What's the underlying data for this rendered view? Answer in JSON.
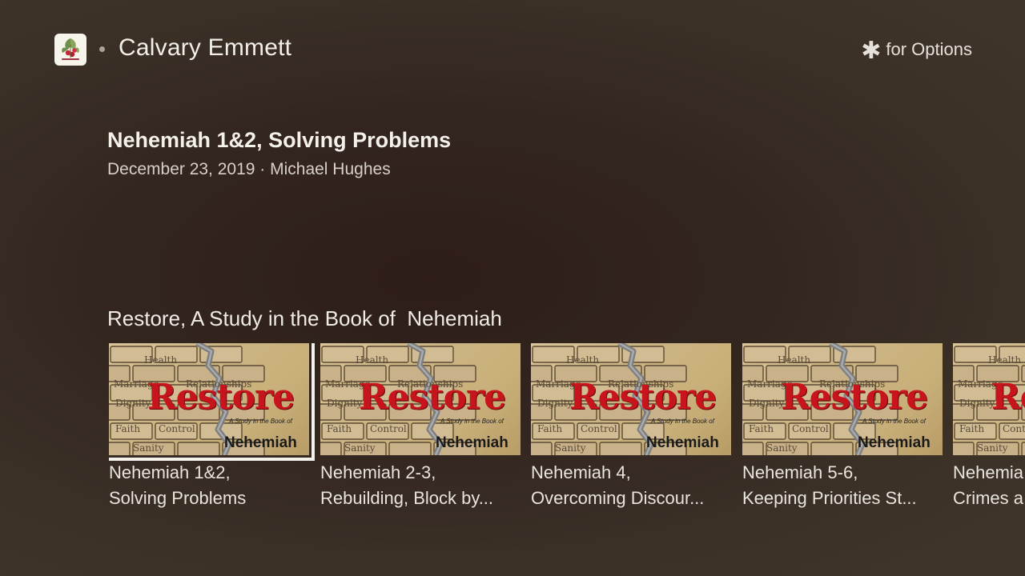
{
  "header": {
    "channel_name": "Calvary Emmett",
    "options_symbol": "✱",
    "options_text": "for Options"
  },
  "episode": {
    "title": "Nehemiah 1&2, Solving Problems",
    "meta": "December 23, 2019 · Michael Hughes"
  },
  "row": {
    "title": "Restore, A Study in the Book of  Nehemiah",
    "thumb": {
      "main_word": "Restore",
      "subtitle": "A Study in the Book of",
      "book": "Nehemiah",
      "brick_words": [
        "Health",
        "Marriage",
        "Relationships",
        "Dignity",
        "Faith",
        "Control",
        "Sanity"
      ]
    },
    "items": [
      {
        "line1": "Nehemiah 1&2,",
        "line2": "Solving Problems"
      },
      {
        "line1": "Nehemiah 2-3,",
        "line2": "Rebuilding, Block by..."
      },
      {
        "line1": "Nehemiah 4,",
        "line2": "Overcoming Discour..."
      },
      {
        "line1": "Nehemiah 5-6,",
        "line2": "Keeping Priorities St..."
      },
      {
        "line1": "Nehemia",
        "line2": "Crimes a"
      }
    ]
  },
  "colors": {
    "restore_red": "#c8141c",
    "focus_outline": "#f4f1ec"
  }
}
